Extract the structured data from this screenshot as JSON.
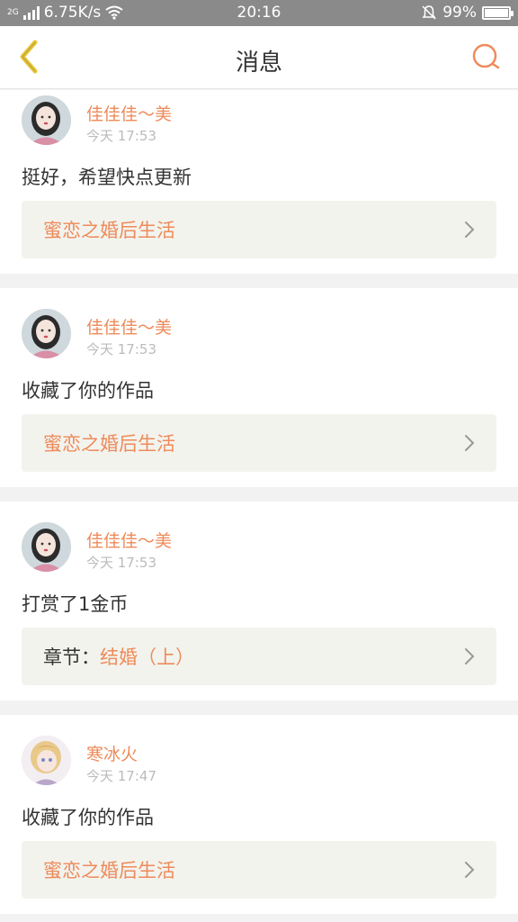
{
  "status_bar": {
    "network": "2G",
    "speed": "6.75K/s",
    "time": "20:16",
    "battery": "99%",
    "battery_level": 0.99
  },
  "nav": {
    "title": "消息",
    "back_icon": "chevron-left-icon",
    "search_icon": "search-icon"
  },
  "colors": {
    "accent": "#ee8b5a",
    "back_icon": "#e8c534",
    "text": "#333333",
    "muted": "#bbbbbb",
    "ref_bg": "#f3f3ee"
  },
  "messages": [
    {
      "user": "佳佳佳～美",
      "time": "今天 17:53",
      "text": "挺好，希望快点更新",
      "ref_prefix": "",
      "ref_title": "蜜恋之婚后生活"
    },
    {
      "user": "佳佳佳～美",
      "time": "今天 17:53",
      "text": "收藏了你的作品",
      "ref_prefix": "",
      "ref_title": "蜜恋之婚后生活"
    },
    {
      "user": "佳佳佳～美",
      "time": "今天 17:53",
      "text": "打赏了1金币",
      "ref_prefix": "章节：",
      "ref_title": "结婚（上）"
    },
    {
      "user": "寒冰火",
      "time": "今天 17:47",
      "text": "收藏了你的作品",
      "ref_prefix": "",
      "ref_title": "蜜恋之婚后生活"
    }
  ]
}
